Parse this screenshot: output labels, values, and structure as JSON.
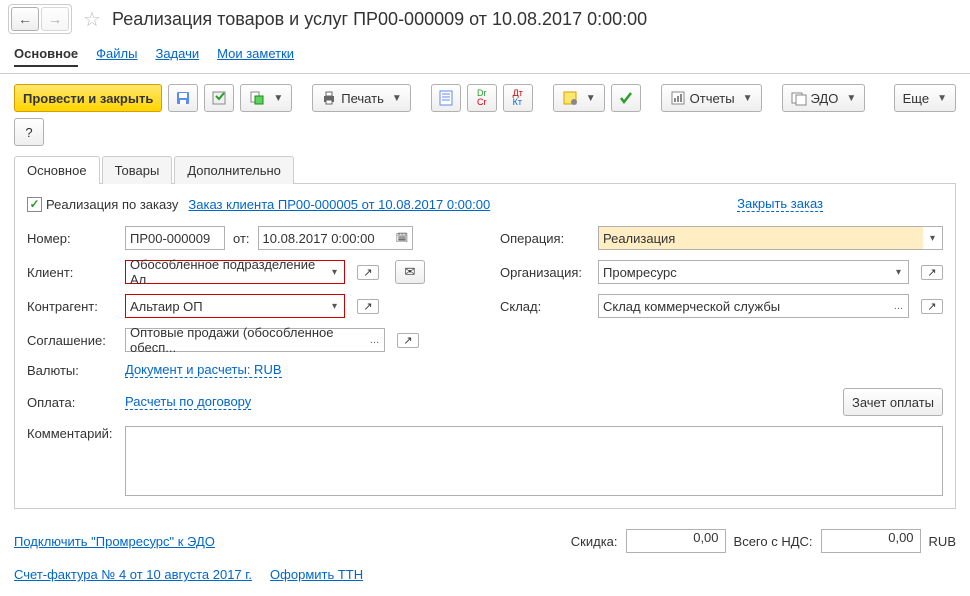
{
  "header": {
    "title": "Реализация товаров и услуг ПР00-000009 от 10.08.2017 0:00:00"
  },
  "navTabs": {
    "main": "Основное",
    "files": "Файлы",
    "tasks": "Задачи",
    "notes": "Мои заметки"
  },
  "toolbar": {
    "postAndClose": "Провести и закрыть",
    "print": "Печать",
    "reports": "Отчеты",
    "edo": "ЭДО",
    "more": "Еще"
  },
  "contentTabs": {
    "main": "Основное",
    "goods": "Товары",
    "extra": "Дополнительно"
  },
  "form": {
    "byOrderLabel": "Реализация по заказу",
    "orderLink": "Заказ клиента ПР00-000005 от 10.08.2017 0:00:00",
    "closeOrderLink": "Закрыть заказ",
    "numberLabel": "Номер:",
    "numberValue": "ПР00-000009",
    "fromLabel": "от:",
    "dateValue": "10.08.2017  0:00:00",
    "operationLabel": "Операция:",
    "operationValue": "Реализация",
    "clientLabel": "Клиент:",
    "clientValue": "Обособленное подразделение Ал",
    "organizationLabel": "Организация:",
    "organizationValue": "Промресурс",
    "partnerLabel": "Контрагент:",
    "partnerValue": "Альтаир ОП",
    "warehouseLabel": "Склад:",
    "warehouseValue": "Склад коммерческой службы",
    "agreementLabel": "Соглашение:",
    "agreementValue": "Оптовые продажи (обособленное обесп...",
    "currencyLabel": "Валюты:",
    "currencyLink": "Документ и расчеты: RUB",
    "paymentLabel": "Оплата:",
    "paymentLink": "Расчеты по договору",
    "paymentBtn": "Зачет оплаты",
    "commentLabel": "Комментарий:"
  },
  "footer": {
    "edoLink": "Подключить \"Промресурс\" к ЭДО",
    "discountLabel": "Скидка:",
    "discountValue": "0,00",
    "totalLabel": "Всего с НДС:",
    "totalValue": "0,00",
    "currency": "RUB",
    "invoiceLink": "Счет-фактура № 4 от 10 августа 2017 г.",
    "ttnLink": "Оформить ТТН"
  }
}
